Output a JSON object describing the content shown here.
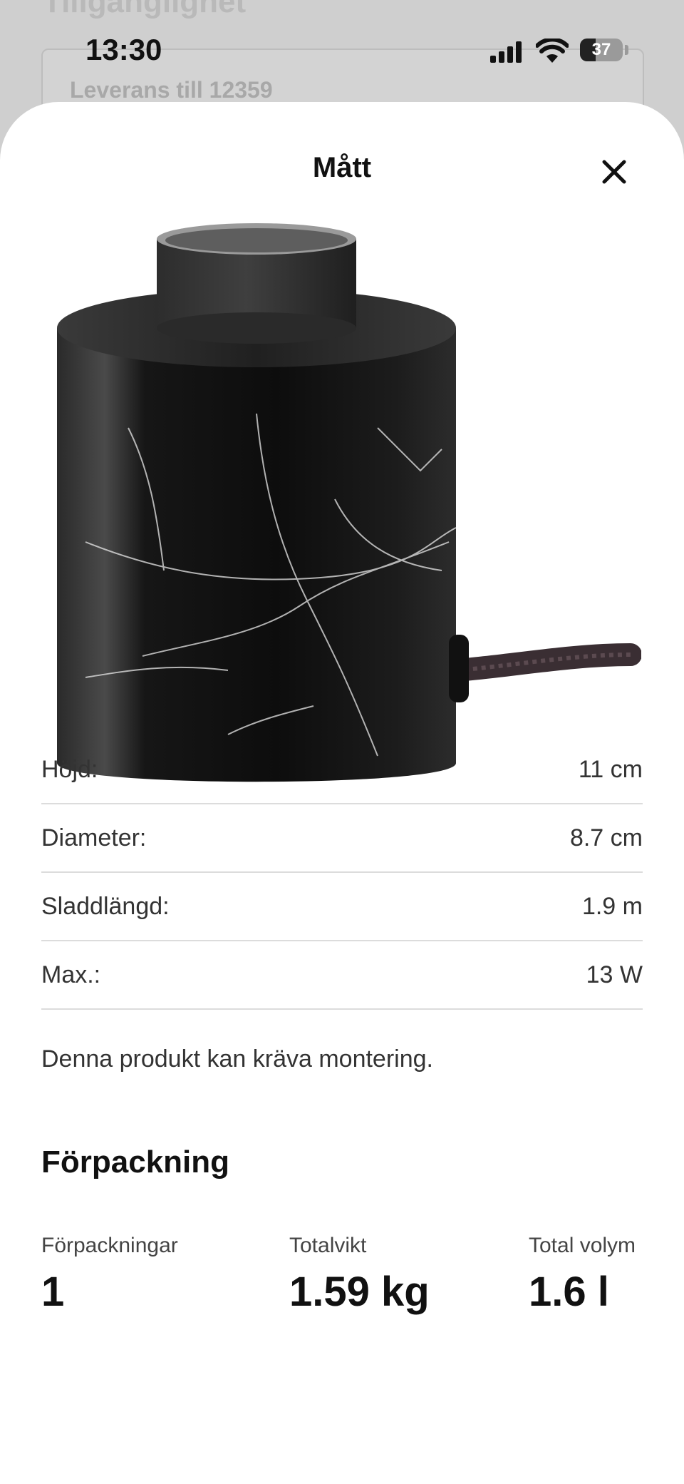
{
  "background": {
    "title": "Tillgänglighet",
    "delivery": "Leverans till 12359"
  },
  "status_bar": {
    "time": "13:30",
    "battery": "37",
    "icons": [
      "signal-icon",
      "wifi-icon",
      "battery-icon"
    ]
  },
  "sheet": {
    "title": "Mått",
    "close_icon": "close-icon"
  },
  "specs": [
    {
      "label": "Höjd:",
      "value": "11 cm"
    },
    {
      "label": "Diameter:",
      "value": "8.7 cm"
    },
    {
      "label": "Sladdlängd:",
      "value": "1.9 m"
    },
    {
      "label": "Max.:",
      "value": "13 W"
    }
  ],
  "assembly_note": "Denna produkt kan kräva montering.",
  "packaging": {
    "title": "Förpackning",
    "items": [
      {
        "label": "Förpackningar",
        "value": "1"
      },
      {
        "label": "Totalvikt",
        "value": "1.59 kg"
      },
      {
        "label": "Total volym",
        "value": "1.6 l"
      }
    ]
  },
  "colors": {
    "sheet_background": "#ffffff",
    "text_primary": "#111111",
    "divider": "#dcdcdc"
  }
}
